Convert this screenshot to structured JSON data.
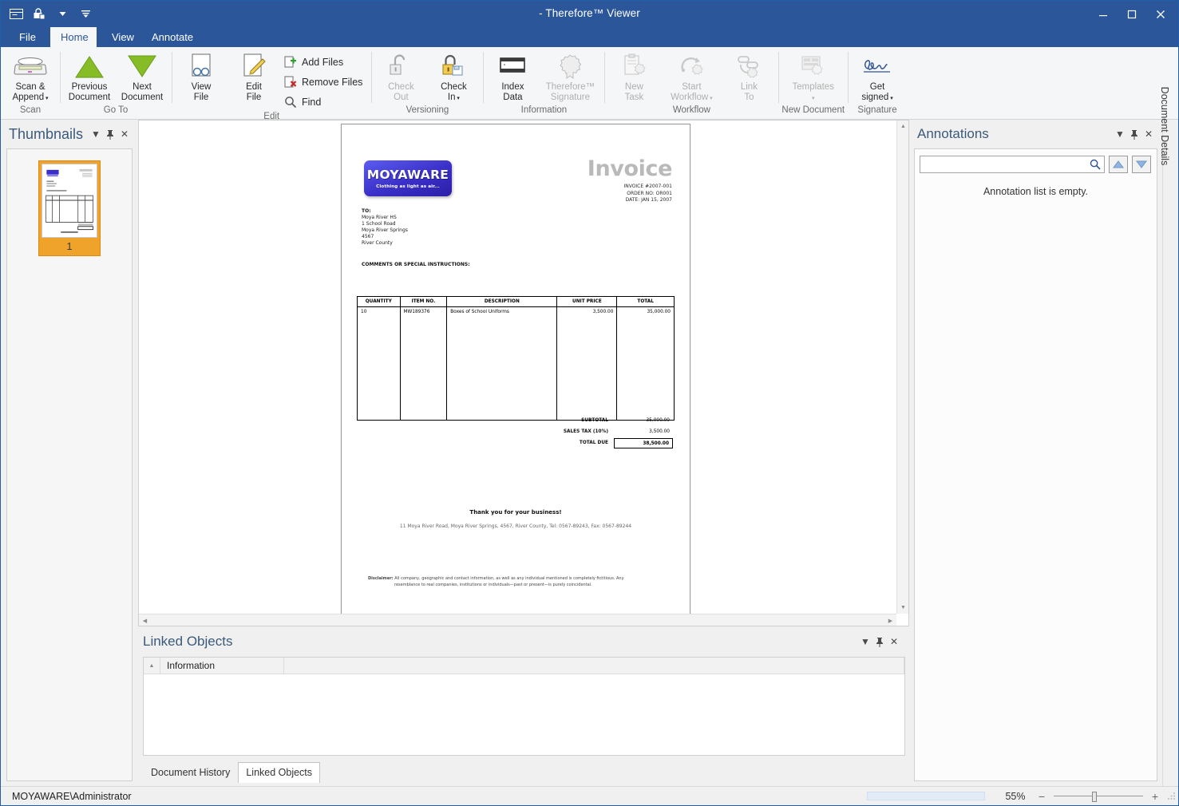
{
  "window": {
    "title": "- Therefore™ Viewer",
    "quick_access": [
      "window-icon",
      "lock-icon",
      "dropdown-caret",
      "customize-caret"
    ],
    "buttons": {
      "minimize": "—",
      "maximize": "❐",
      "close": "✕"
    },
    "ribbon_collapse": "ᴧ",
    "help": "?"
  },
  "tabs": [
    {
      "label": "File",
      "active": false
    },
    {
      "label": "Home",
      "active": true
    },
    {
      "label": "View",
      "active": false
    },
    {
      "label": "Annotate",
      "active": false
    }
  ],
  "ribbon": {
    "groups": [
      {
        "label": "Scan",
        "buttons": [
          {
            "name": "scan-append",
            "line1": "Scan &",
            "line2": "Append",
            "caret": true,
            "disabled": false
          }
        ]
      },
      {
        "label": "Go To",
        "buttons": [
          {
            "name": "previous-document",
            "line1": "Previous",
            "line2": "Document",
            "caret": false,
            "disabled": false
          },
          {
            "name": "next-document",
            "line1": "Next",
            "line2": "Document",
            "caret": false,
            "disabled": false
          }
        ]
      },
      {
        "label": "Edit",
        "buttons": [
          {
            "name": "view-file",
            "line1": "View",
            "line2": "File",
            "caret": false,
            "disabled": false
          },
          {
            "name": "edit-file",
            "line1": "Edit",
            "line2": "File",
            "caret": false,
            "disabled": false
          }
        ],
        "small_buttons": [
          {
            "name": "add-files",
            "label": "Add Files"
          },
          {
            "name": "remove-files",
            "label": "Remove Files"
          },
          {
            "name": "find",
            "label": "Find"
          }
        ]
      },
      {
        "label": "Versioning",
        "buttons": [
          {
            "name": "check-out",
            "line1": "Check",
            "line2": "Out",
            "caret": false,
            "disabled": true
          },
          {
            "name": "check-in",
            "line1": "Check",
            "line2": "In",
            "caret": true,
            "disabled": false
          }
        ]
      },
      {
        "label": "Information",
        "buttons": [
          {
            "name": "index-data",
            "line1": "Index",
            "line2": "Data",
            "caret": false,
            "disabled": false
          },
          {
            "name": "therefore-signature",
            "line1": "Therefore™",
            "line2": "Signature",
            "caret": false,
            "disabled": true
          }
        ]
      },
      {
        "label": "Workflow",
        "buttons": [
          {
            "name": "new-task",
            "line1": "New",
            "line2": "Task",
            "caret": false,
            "disabled": true
          },
          {
            "name": "start-workflow",
            "line1": "Start",
            "line2": "Workflow",
            "caret": true,
            "disabled": true
          },
          {
            "name": "link-to",
            "line1": "Link",
            "line2": "To",
            "caret": false,
            "disabled": true
          }
        ]
      },
      {
        "label": "New Document",
        "buttons": [
          {
            "name": "templates",
            "line1": "Templates",
            "line2": "",
            "caret": true,
            "disabled": true
          }
        ]
      },
      {
        "label": "Signature",
        "buttons": [
          {
            "name": "get-signed",
            "line1": "Get",
            "line2": "signed",
            "caret": true,
            "disabled": false
          }
        ]
      }
    ]
  },
  "thumbnails": {
    "title": "Thumbnails",
    "controls": {
      "menu": "▼",
      "pin": "⚲",
      "close": "✕"
    },
    "pages": [
      {
        "number": "1",
        "selected": true
      }
    ]
  },
  "annotations": {
    "title": "Annotations",
    "controls": {
      "menu": "▼",
      "pin": "⚲",
      "close": "✕"
    },
    "search_value": "",
    "search_placeholder": "",
    "nav_up": "▲",
    "nav_down": "▼",
    "empty_message": "Annotation list is empty."
  },
  "document_details_tab": "Document Details",
  "linked_objects": {
    "title": "Linked Objects",
    "controls": {
      "menu": "▼",
      "pin": "⚲",
      "close": "✕"
    },
    "columns": [
      "Information",
      ""
    ],
    "rows": [],
    "bottom_tabs": [
      {
        "label": "Document History",
        "active": false
      },
      {
        "label": "Linked Objects",
        "active": true
      }
    ]
  },
  "invoice": {
    "logo_text": "MOYAWARE",
    "logo_tagline": "Clothing as light as air...",
    "heading": "Invoice",
    "meta": [
      "INVOICE #2007-001",
      "ORDER NO: OR001",
      "DATE: JAN 15, 2007"
    ],
    "to_label": "TO:",
    "to_lines": [
      "Moya River  HS",
      "1 School Road",
      "Moya River Springs",
      " 4567",
      " River County"
    ],
    "comments_label": "COMMENTS OR SPECIAL INSTRUCTIONS:",
    "table": {
      "columns": [
        "QUANTITY",
        "ITEM NO.",
        "DESCRIPTION",
        "UNIT PRICE",
        "TOTAL"
      ],
      "rows": [
        {
          "quantity": "10",
          "item_no": "MW189376",
          "description": "Boxes of School Uniforms",
          "unit_price": "3,500.00",
          "total": "35,000.00"
        }
      ]
    },
    "totals": [
      {
        "label": "SUBTOTAL",
        "value": "35,000.00",
        "grand": false
      },
      {
        "label": "SALES TAX (10%)",
        "value": "3,500.00",
        "grand": false
      },
      {
        "label": "TOTAL DUE",
        "value": "38,500.00",
        "grand": true
      }
    ],
    "thanks": "Thank you for your business!",
    "address": "11 Moya River Road, Moya River Springs, 4567, River County, Tel: 0567-89243, Fax: 0567-89244",
    "disclaimer_label": "Disclaimer:",
    "disclaimer_line1": "All company, geographic and contact information, as well as any individual mentioned is completely fictitious.  Any",
    "disclaimer_line2": "resemblance to real companies, institutions or individuals—past or present—is purely coincidental."
  },
  "statusbar": {
    "user": "MOYAWARE\\Administrator",
    "zoom_level": "55%",
    "zoom_out": "−",
    "zoom_in": "+",
    "resize_grip": "◢"
  },
  "colors": {
    "accent": "#2b579a",
    "ribbon_bg": "#f5f6f7",
    "thumb_selected": "#f0a32a",
    "pane_title": "#3b5a7a",
    "green_arrow": "#76b900"
  }
}
